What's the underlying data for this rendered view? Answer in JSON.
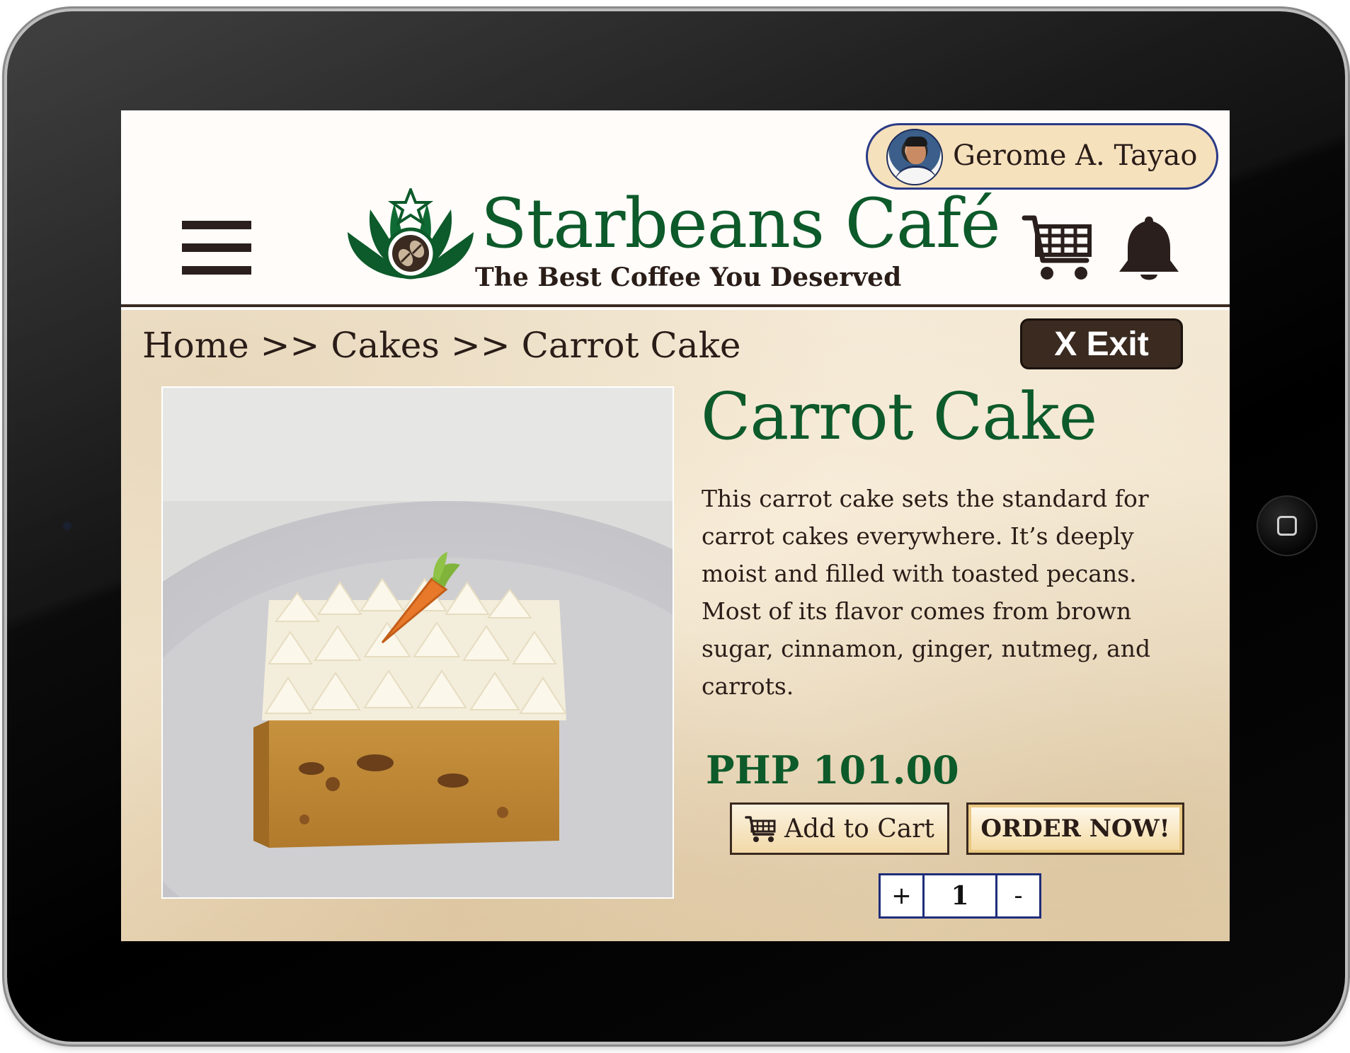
{
  "user": {
    "name": "Gerome A. Tayao"
  },
  "brand": {
    "name": "Starbeans Café",
    "tagline": "The Best Coffee You Deserved",
    "primary_color": "#0d5a2a",
    "dark_color": "#3a2a20"
  },
  "header": {
    "menu_icon": "hamburger-icon",
    "cart_icon": "shopping-cart-icon",
    "notification_icon": "bell-icon"
  },
  "breadcrumb": {
    "items": [
      "Home",
      "Cakes",
      "Carrot Cake"
    ],
    "separator": ">>"
  },
  "exit_button": {
    "label": "X Exit"
  },
  "product": {
    "title": "Carrot Cake",
    "description": "This carrot cake sets the standard for carrot cakes everywhere. It’s deeply moist and filled with toasted pecans. Most of its flavor comes from brown sugar, cinnamon, ginger, nutmeg, and carrots.",
    "price": "PHP 101.00",
    "image": "carrot-cake-photo"
  },
  "actions": {
    "add_to_cart_label": "Add to Cart",
    "add_to_cart_icon": "shopping-cart-icon",
    "order_now_label": "ORDER NOW!"
  },
  "quantity": {
    "increment_label": "+",
    "value": "1",
    "decrement_label": "-",
    "border_color": "#1f2d7a"
  }
}
